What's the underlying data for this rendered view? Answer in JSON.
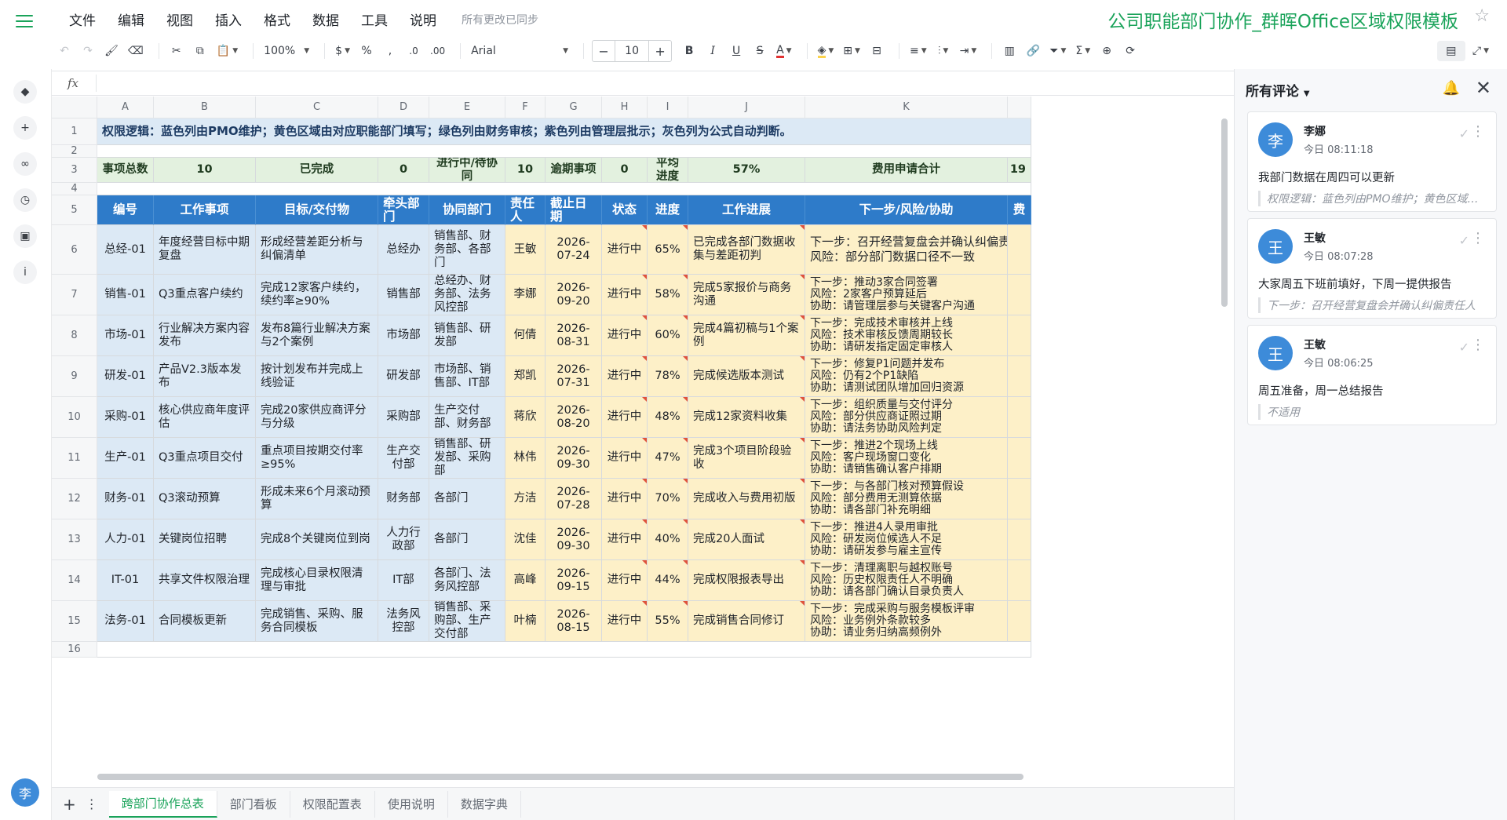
{
  "menu": {
    "items": [
      "文件",
      "编辑",
      "视图",
      "插入",
      "格式",
      "数据",
      "工具",
      "说明"
    ],
    "sync_status": "所有更改已同步"
  },
  "doc_title": "公司职能部门协作_群晖Office区域权限模板",
  "toolbar": {
    "zoom": "100%",
    "currency": "$",
    "percent": "%",
    "comma": ",",
    "dec_minus": ".0",
    "dec_plus": ".00",
    "font": "Arial",
    "font_size": "10",
    "bold": "B",
    "italic": "I",
    "underline": "U",
    "strike": "S",
    "text_color": "A"
  },
  "formula_bar": {
    "fx": "fx"
  },
  "columns": [
    "A",
    "B",
    "C",
    "D",
    "E",
    "F",
    "G",
    "H",
    "I",
    "J",
    "K"
  ],
  "rows": [
    "1",
    "2",
    "3",
    "4",
    "5",
    "6",
    "7",
    "8",
    "9",
    "10",
    "11",
    "12",
    "13",
    "14",
    "15",
    "16"
  ],
  "banner": "权限逻辑：蓝色列由PMO维护；黄色区域由对应职能部门填写；绿色列由财务审核；紫色列由管理层批示；灰色列为公式自动判断。",
  "summary": {
    "total_label": "事项总数",
    "total": "10",
    "done_label": "已完成",
    "done": "0",
    "progress_label": "进行中/待协同",
    "progress": "10",
    "overdue_label": "逾期事项",
    "overdue": "0",
    "avg_label": "平均进度",
    "avg": "57%",
    "fee_label": "费用申请合计",
    "fee": "19"
  },
  "headers": [
    "编号",
    "工作事项",
    "目标/交付物",
    "牵头部门",
    "协同部门",
    "责任人",
    "截止日期",
    "状态",
    "进度",
    "工作进展",
    "下一步/风险/协助",
    "费"
  ],
  "table": [
    {
      "id": "总经-01",
      "item": "年度经营目标中期复盘",
      "goal": "形成经营差距分析与纠偏清单",
      "lead": "总经办",
      "coop": "销售部、财务部、各部门",
      "owner": "王敏",
      "due": "2026-07-24",
      "status": "进行中",
      "pct": "65%",
      "progress": "已完成各部门数据收集与差距初判",
      "notes": [
        "下一步：召开经营复盘会并确认纠偏责任人",
        "风险：部分部门数据口径不一致"
      ]
    },
    {
      "id": "销售-01",
      "item": "Q3重点客户续约",
      "goal": "完成12家客户续约，续约率≥90%",
      "lead": "销售部",
      "coop": "总经办、财务部、法务风控部",
      "owner": "李娜",
      "due": "2026-09-20",
      "status": "进行中",
      "pct": "58%",
      "progress": "完成5家报价与商务沟通",
      "notes": [
        "下一步：推动3家合同签署",
        "风险：2家客户预算延后",
        "协助：请管理层参与关键客户沟通"
      ]
    },
    {
      "id": "市场-01",
      "item": "行业解决方案内容发布",
      "goal": "发布8篇行业解决方案与2个案例",
      "lead": "市场部",
      "coop": "销售部、研发部",
      "owner": "何倩",
      "due": "2026-08-31",
      "status": "进行中",
      "pct": "60%",
      "progress": "完成4篇初稿与1个案例",
      "notes": [
        "下一步：完成技术审核并上线",
        "风险：技术审核反馈周期较长",
        "协助：请研发指定固定审核人"
      ]
    },
    {
      "id": "研发-01",
      "item": "产品V2.3版本发布",
      "goal": "按计划发布并完成上线验证",
      "lead": "研发部",
      "coop": "市场部、销售部、IT部",
      "owner": "郑凯",
      "due": "2026-07-31",
      "status": "进行中",
      "pct": "78%",
      "progress": "完成候选版本测试",
      "notes": [
        "下一步：修复P1问题并发布",
        "风险：仍有2个P1缺陷",
        "协助：请测试团队增加回归资源"
      ]
    },
    {
      "id": "采购-01",
      "item": "核心供应商年度评估",
      "goal": "完成20家供应商评分与分级",
      "lead": "采购部",
      "coop": "生产交付部、财务部",
      "owner": "蒋欣",
      "due": "2026-08-20",
      "status": "进行中",
      "pct": "48%",
      "progress": "完成12家资料收集",
      "notes": [
        "下一步：组织质量与交付评分",
        "风险：部分供应商证照过期",
        "协助：请法务协助风险判定"
      ]
    },
    {
      "id": "生产-01",
      "item": "Q3重点项目交付",
      "goal": "重点项目按期交付率≥95%",
      "lead": "生产交付部",
      "coop": "销售部、研发部、采购部",
      "owner": "林伟",
      "due": "2026-09-30",
      "status": "进行中",
      "pct": "47%",
      "progress": "完成3个项目阶段验收",
      "notes": [
        "下一步：推进2个现场上线",
        "风险：客户现场窗口变化",
        "协助：请销售确认客户排期"
      ]
    },
    {
      "id": "财务-01",
      "item": "Q3滚动预算",
      "goal": "形成未来6个月滚动预算",
      "lead": "财务部",
      "coop": "各部门",
      "owner": "方洁",
      "due": "2026-07-28",
      "status": "进行中",
      "pct": "70%",
      "progress": "完成收入与费用初版",
      "notes": [
        "下一步：与各部门核对预算假设",
        "风险：部分费用无测算依据",
        "协助：请各部门补充明细"
      ]
    },
    {
      "id": "人力-01",
      "item": "关键岗位招聘",
      "goal": "完成8个关键岗位到岗",
      "lead": "人力行政部",
      "coop": "各部门",
      "owner": "沈佳",
      "due": "2026-09-30",
      "status": "进行中",
      "pct": "40%",
      "progress": "完成20人面试",
      "notes": [
        "下一步：推进4人录用审批",
        "风险：研发岗位候选人不足",
        "协助：请研发参与雇主宣传"
      ]
    },
    {
      "id": "IT-01",
      "item": "共享文件权限治理",
      "goal": "完成核心目录权限清理与审批",
      "lead": "IT部",
      "coop": "各部门、法务风控部",
      "owner": "高峰",
      "due": "2026-09-15",
      "status": "进行中",
      "pct": "44%",
      "progress": "完成权限报表导出",
      "notes": [
        "下一步：清理离职与越权账号",
        "风险：历史权限责任人不明确",
        "协助：请各部门确认目录负责人"
      ]
    },
    {
      "id": "法务-01",
      "item": "合同模板更新",
      "goal": "完成销售、采购、服务合同模板",
      "lead": "法务风控部",
      "coop": "销售部、采购部、生产交付部",
      "owner": "叶楠",
      "due": "2026-08-15",
      "status": "进行中",
      "pct": "55%",
      "progress": "完成销售合同修订",
      "notes": [
        "下一步：完成采购与服务模板评审",
        "风险：业务例外条款较多",
        "协助：请业务归纳高频例外"
      ]
    }
  ],
  "sheet_tabs": [
    "跨部门协作总表",
    "部门看板",
    "权限配置表",
    "使用说明",
    "数据字典"
  ],
  "comments": {
    "title": "所有评论",
    "items": [
      {
        "avatar": "李",
        "name": "李娜",
        "time": "今日 08:11:18",
        "body": "我部门数据在周四可以更新",
        "quote": "权限逻辑：蓝色列由PMO维护；黄色区域由对应职能部门填写；绿色列由财务审核；紫色列由管理层批示；灰色列为公式自动判断。"
      },
      {
        "avatar": "王",
        "name": "王敏",
        "time": "今日 08:07:28",
        "body": "大家周五下班前填好，下周一提供报告",
        "quote": "下一步：召开经营复盘会并确认纠偏责任人"
      },
      {
        "avatar": "王",
        "name": "王敏",
        "time": "今日 08:06:25",
        "body": "周五准备，周一总结报告",
        "quote": "不适用"
      }
    ]
  },
  "user_avatar": "李",
  "colors": {
    "accent": "#1aa35a",
    "header_blue": "#2e7bc9",
    "blue_col": "#dce9f5",
    "yellow_col": "#fdf0c8",
    "green_row": "#e3f1df"
  }
}
